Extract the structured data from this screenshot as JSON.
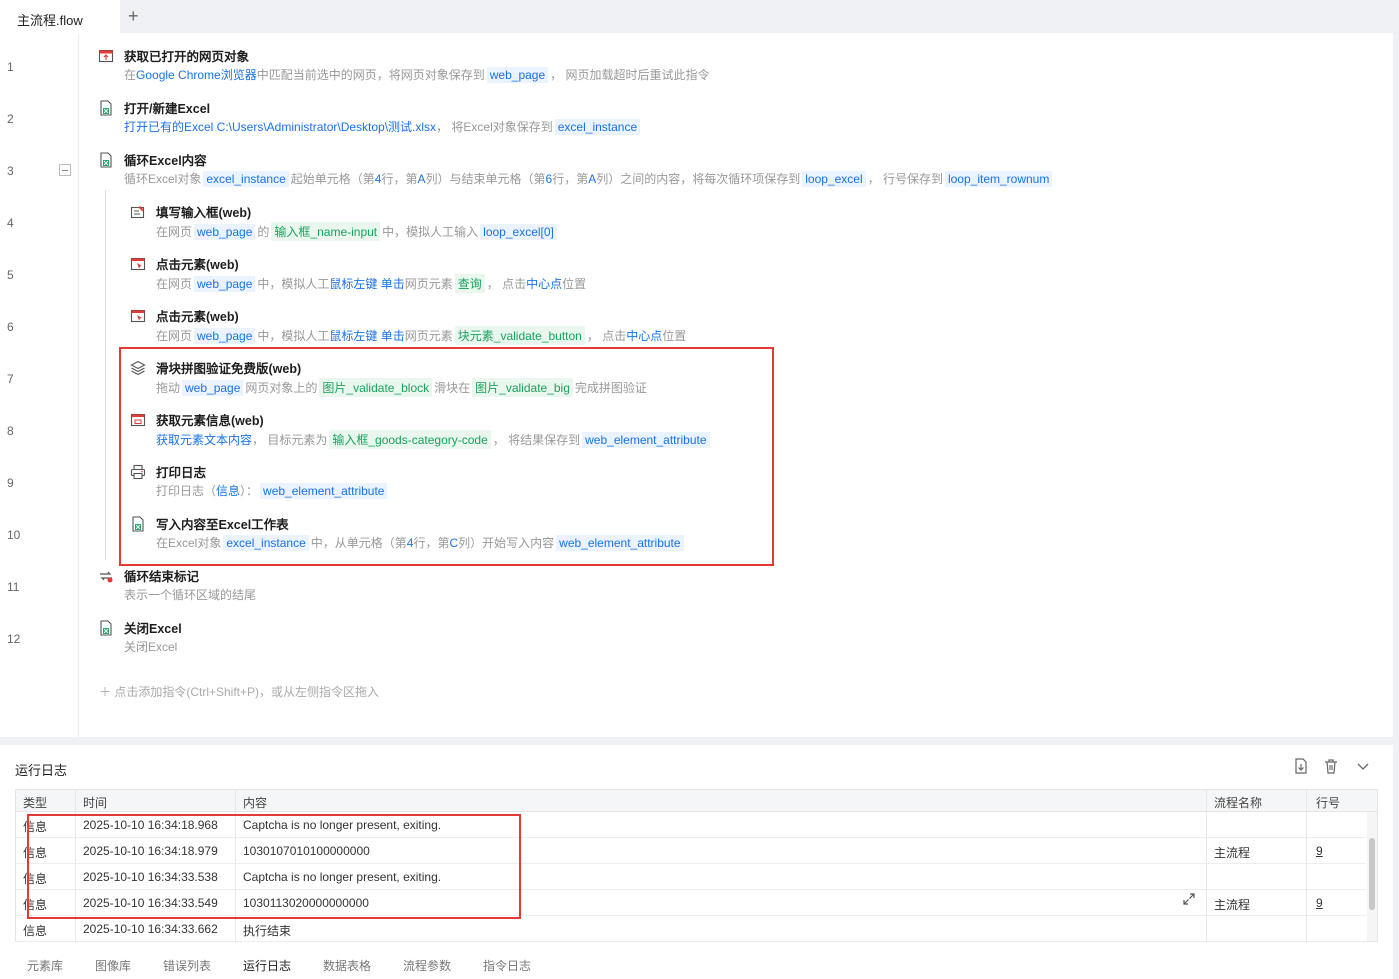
{
  "tabs": {
    "active": "主流程.flow",
    "add": "+"
  },
  "line_numbers": [
    "1",
    "2",
    "3",
    "4",
    "5",
    "6",
    "7",
    "8",
    "9",
    "10",
    "11",
    "12"
  ],
  "steps": [
    {
      "title": "获取已打开的网页对象",
      "desc": [
        {
          "t": "在 ",
          "c": "p"
        },
        {
          "t": "Google Chrome浏览器",
          "c": "k"
        },
        {
          "t": " 中匹配当前选中的网页，将网页对象保存到 ",
          "c": "p"
        },
        {
          "t": "web_page",
          "c": "v"
        },
        {
          "t": "， 网页加载超时后重试此指令",
          "c": "p"
        }
      ]
    },
    {
      "title": "打开/新建Excel",
      "desc": [
        {
          "t": "打开已有的Excel  C:\\Users\\Administrator\\Desktop\\测试.xlsx",
          "c": "k"
        },
        {
          "t": "， 将Excel对象保存到 ",
          "c": "p"
        },
        {
          "t": "excel_instance",
          "c": "v"
        }
      ]
    },
    {
      "title": "循环Excel内容",
      "desc": [
        {
          "t": "循环Excel对象 ",
          "c": "p"
        },
        {
          "t": "excel_instance",
          "c": "v"
        },
        {
          "t": " 起始单元格（第 ",
          "c": "p"
        },
        {
          "t": "4",
          "c": "k"
        },
        {
          "t": " 行，第 ",
          "c": "p"
        },
        {
          "t": "A",
          "c": "k"
        },
        {
          "t": " 列）与结束单元格（第 ",
          "c": "p"
        },
        {
          "t": "6",
          "c": "k"
        },
        {
          "t": " 行，第 ",
          "c": "p"
        },
        {
          "t": "A",
          "c": "k"
        },
        {
          "t": " 列）之间的内容，将每次循环项保存到 ",
          "c": "p"
        },
        {
          "t": "loop_excel",
          "c": "v"
        },
        {
          "t": "， 行号保存到 ",
          "c": "p"
        },
        {
          "t": "loop_item_rownum",
          "c": "v"
        }
      ]
    },
    {
      "title": "填写输入框(web)",
      "desc": [
        {
          "t": "在网页 ",
          "c": "p"
        },
        {
          "t": "web_page",
          "c": "v"
        },
        {
          "t": " 的 ",
          "c": "p"
        },
        {
          "t": "输入框_name-input",
          "c": "e"
        },
        {
          "t": " 中，模拟人工输入 ",
          "c": "p"
        },
        {
          "t": "loop_excel[0]",
          "c": "v"
        }
      ]
    },
    {
      "title": "点击元素(web)",
      "desc": [
        {
          "t": "在网页 ",
          "c": "p"
        },
        {
          "t": "web_page",
          "c": "v"
        },
        {
          "t": " 中，模拟人工 ",
          "c": "p"
        },
        {
          "t": "鼠标左键 单击",
          "c": "k"
        },
        {
          "t": " 网页元素 ",
          "c": "p"
        },
        {
          "t": "查询",
          "c": "e"
        },
        {
          "t": "， 点击 ",
          "c": "p"
        },
        {
          "t": "中心点",
          "c": "k"
        },
        {
          "t": " 位置",
          "c": "p"
        }
      ]
    },
    {
      "title": "点击元素(web)",
      "desc": [
        {
          "t": "在网页 ",
          "c": "p"
        },
        {
          "t": "web_page",
          "c": "v"
        },
        {
          "t": " 中，模拟人工 ",
          "c": "p"
        },
        {
          "t": "鼠标左键 单击",
          "c": "k"
        },
        {
          "t": " 网页元素 ",
          "c": "p"
        },
        {
          "t": "块元素_validate_button",
          "c": "e"
        },
        {
          "t": "， 点击 ",
          "c": "p"
        },
        {
          "t": "中心点",
          "c": "k"
        },
        {
          "t": " 位置",
          "c": "p"
        }
      ]
    },
    {
      "title": "滑块拼图验证免费版(web)",
      "desc": [
        {
          "t": "拖动 ",
          "c": "p"
        },
        {
          "t": "web_page",
          "c": "v"
        },
        {
          "t": " 网页对象上的 ",
          "c": "p"
        },
        {
          "t": "图片_validate_block",
          "c": "e"
        },
        {
          "t": " 滑块在 ",
          "c": "p"
        },
        {
          "t": "图片_validate_big",
          "c": "e"
        },
        {
          "t": " 完成拼图验证",
          "c": "p"
        }
      ]
    },
    {
      "title": "获取元素信息(web)",
      "desc": [
        {
          "t": "获取元素文本内容",
          "c": "k"
        },
        {
          "t": "， 目标元素为 ",
          "c": "p"
        },
        {
          "t": "输入框_goods-category-code",
          "c": "e"
        },
        {
          "t": "， 将结果保存到 ",
          "c": "p"
        },
        {
          "t": "web_element_attribute",
          "c": "v"
        }
      ]
    },
    {
      "title": "打印日志",
      "desc": [
        {
          "t": "打印日志（ ",
          "c": "p"
        },
        {
          "t": "信息",
          "c": "k"
        },
        {
          "t": " ）： ",
          "c": "p"
        },
        {
          "t": "web_element_attribute",
          "c": "v"
        }
      ]
    },
    {
      "title": "写入内容至Excel工作表",
      "desc": [
        {
          "t": "在Excel对象 ",
          "c": "p"
        },
        {
          "t": "excel_instance",
          "c": "v"
        },
        {
          "t": " 中，从单元格（第 ",
          "c": "p"
        },
        {
          "t": "4",
          "c": "k"
        },
        {
          "t": " 行，第 ",
          "c": "p"
        },
        {
          "t": "C",
          "c": "k"
        },
        {
          "t": " 列）开始写入内容 ",
          "c": "p"
        },
        {
          "t": "web_element_attribute",
          "c": "v"
        }
      ]
    },
    {
      "title": "循环结束标记",
      "desc": [
        {
          "t": "表示一个循环区域的结尾",
          "c": "p"
        }
      ]
    },
    {
      "title": "关闭Excel",
      "desc": [
        {
          "t": "关闭Excel",
          "c": "p"
        }
      ]
    }
  ],
  "add_hint": "＋ 点击添加指令(Ctrl+Shift+P)，或从左侧指令区拖入",
  "log": {
    "title": "运行日志",
    "columns": [
      "类型",
      "时间",
      "内容",
      "流程名称",
      "行号"
    ],
    "rows": [
      {
        "type": "信息",
        "time": "2025-10-10 16:34:18.968",
        "content": "Captcha is no longer present, exiting.",
        "flow": "",
        "line": ""
      },
      {
        "type": "信息",
        "time": "2025-10-10 16:34:18.979",
        "content": "1030107010100000000",
        "flow": "主流程",
        "line": "9"
      },
      {
        "type": "信息",
        "time": "2025-10-10 16:34:33.538",
        "content": "Captcha is no longer present, exiting.",
        "flow": "",
        "line": ""
      },
      {
        "type": "信息",
        "time": "2025-10-10 16:34:33.549",
        "content": "1030113020000000000",
        "flow": "主流程",
        "line": "9"
      },
      {
        "type": "信息",
        "time": "2025-10-10 16:34:33.662",
        "content": "执行结束",
        "flow": "",
        "line": ""
      }
    ]
  },
  "bottom_tabs": [
    {
      "label": "元素库",
      "active": false
    },
    {
      "label": "图像库",
      "active": false
    },
    {
      "label": "错误列表",
      "active": false
    },
    {
      "label": "运行日志",
      "active": true
    },
    {
      "label": "数据表格",
      "active": false
    },
    {
      "label": "流程参数",
      "active": false
    },
    {
      "label": "指令日志",
      "active": false
    }
  ],
  "icons": [
    "browser-icon",
    "excel-icon",
    "excel-loop-icon",
    "input-edit-icon",
    "click-icon",
    "click-icon",
    "slider-puzzle-icon",
    "element-info-icon",
    "printer-icon",
    "excel-write-icon",
    "loop-end-icon",
    "excel-close-icon"
  ]
}
